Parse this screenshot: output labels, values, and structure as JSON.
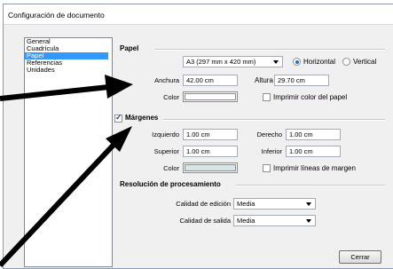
{
  "window": {
    "title": "Configuración de documento"
  },
  "nav": {
    "items": [
      {
        "label": "General",
        "selected": false
      },
      {
        "label": "Cuadrícula",
        "selected": false
      },
      {
        "label": "Papel",
        "selected": true
      },
      {
        "label": "Referencias",
        "selected": false
      },
      {
        "label": "Unidades",
        "selected": false
      }
    ]
  },
  "paper": {
    "title": "Papel",
    "size_value": "A3 (297 mm x 420 mm)",
    "orientation_horizontal": "Horizontal",
    "orientation_vertical": "Vertical",
    "orientation_selected": "Horizontal",
    "width_label": "Anchura",
    "width_value": "42.00 cm",
    "height_label": "Altura",
    "height_value": "29.70 cm",
    "color_label": "Color",
    "color_value": "#ffffff",
    "print_color_label": "Imprimir color del papel",
    "print_color_checked": false
  },
  "margins": {
    "title": "Márgenes",
    "enabled": true,
    "left_label": "Izquierdo",
    "left_value": "1.00 cm",
    "right_label": "Derecho",
    "right_value": "1.00 cm",
    "top_label": "Superior",
    "top_value": "1.00 cm",
    "bottom_label": "Inferior",
    "bottom_value": "1.00 cm",
    "color_label": "Color",
    "color_value": "#d6e6e4",
    "print_lines_label": "Imprimir líneas de margen",
    "print_lines_checked": false
  },
  "rendering": {
    "title": "Resolución de procesamiento",
    "edit_label": "Calidad de edición",
    "edit_value": "Media",
    "output_label": "Calidad de salida",
    "output_value": "Media"
  },
  "actions": {
    "close_label": "Cerrar"
  },
  "colors": {
    "arrow": "#000000",
    "selection": "#3399ff"
  }
}
